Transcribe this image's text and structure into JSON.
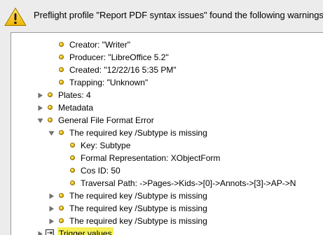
{
  "header": {
    "icon": "warning-icon",
    "message": "Preflight profile \"Report PDF syntax issues\" found the following warnings:"
  },
  "tree": {
    "rows": [
      {
        "label": "Creator: \"Writer\"",
        "level": 2,
        "toggle": "none",
        "icon": "bullet"
      },
      {
        "label": "Producer: \"LibreOffice 5.2\"",
        "level": 2,
        "toggle": "none",
        "icon": "bullet"
      },
      {
        "label": "Created: \"12/22/16 5:35 PM\"",
        "level": 2,
        "toggle": "none",
        "icon": "bullet"
      },
      {
        "label": "Trapping: \"Unknown\"",
        "level": 2,
        "toggle": "none",
        "icon": "bullet"
      },
      {
        "label": "Plates: 4",
        "level": 1,
        "toggle": "collapsed",
        "icon": "bullet"
      },
      {
        "label": "Metadata",
        "level": 1,
        "toggle": "collapsed",
        "icon": "bullet"
      },
      {
        "label": "General File Format Error",
        "level": 1,
        "toggle": "expanded",
        "icon": "bullet"
      },
      {
        "label": "The required key /Subtype is missing",
        "level": 2,
        "toggle": "expanded",
        "icon": "bullet"
      },
      {
        "label": "Key: Subtype",
        "level": 3,
        "toggle": "none",
        "icon": "bullet"
      },
      {
        "label": "Formal Representation: XObjectForm",
        "level": 3,
        "toggle": "none",
        "icon": "bullet"
      },
      {
        "label": "Cos ID: 50",
        "level": 3,
        "toggle": "none",
        "icon": "bullet"
      },
      {
        "label": "Traversal Path: ->Pages->Kids->[0]->Annots->[3]->AP->N",
        "level": 3,
        "toggle": "none",
        "icon": "bullet"
      },
      {
        "label": "The required key /Subtype is missing",
        "level": 2,
        "toggle": "collapsed",
        "icon": "bullet"
      },
      {
        "label": "The required key /Subtype is missing",
        "level": 2,
        "toggle": "collapsed",
        "icon": "bullet"
      },
      {
        "label": "The required key /Subtype is missing",
        "level": 2,
        "toggle": "collapsed",
        "icon": "bullet"
      },
      {
        "label": "Trigger values",
        "level": 0,
        "toggle": "collapsed",
        "icon": "trigger",
        "highlighted": true
      }
    ]
  },
  "colors": {
    "highlight": "#f5ef58",
    "warning": "#f4c20d",
    "bullet": "#f3c81a"
  }
}
